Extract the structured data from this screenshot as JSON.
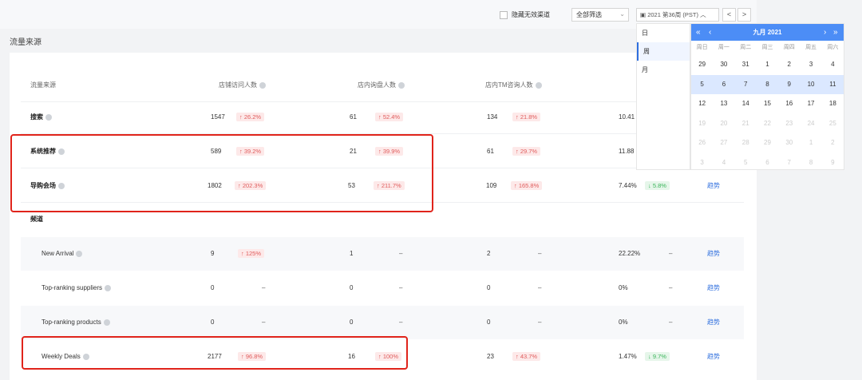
{
  "toolbar": {
    "hide_label": "隐藏无效渠道",
    "filter_value": "全部筛选",
    "date_value": "2021 第36周 (PST)",
    "prev": "<",
    "next": ">"
  },
  "section_title": "流量来源",
  "table": {
    "headers": [
      "流量来源",
      "店铺访问人数",
      "店内询盘人数",
      "店内TM咨询人数"
    ],
    "rows": [
      {
        "name": "搜索",
        "bold": true,
        "v1": "1547",
        "b1": "↑ 26.2%",
        "v2": "61",
        "b2": "↑ 52.4%",
        "v3": "134",
        "b3": "↑ 21.8%",
        "v4": "10.41",
        "b4": "",
        "act": ""
      },
      {
        "name": "系统推荐",
        "bold": true,
        "v1": "589",
        "b1": "↑ 39.2%",
        "v2": "21",
        "b2": "↑ 39.9%",
        "v3": "61",
        "b3": "↑ 29.7%",
        "v4": "11.88",
        "b4": "",
        "act": ""
      },
      {
        "name": "导购会场",
        "bold": true,
        "v1": "1802",
        "b1": "↑ 202.3%",
        "v2": "53",
        "b2": "↑ 211.7%",
        "v3": "109",
        "b3": "↑ 165.8%",
        "v4": "7.44%",
        "b4": "↓ 5.8%",
        "act": "趋势"
      },
      {
        "name": "频道",
        "bold": true
      },
      {
        "name": "New Arrival",
        "bold": false,
        "v1": "9",
        "b1": "↑ 125%",
        "v2": "1",
        "b2": "–",
        "v3": "2",
        "b3": "–",
        "v4": "22.22%",
        "b4": "–",
        "act": "趋势"
      },
      {
        "name": "Top-ranking suppliers",
        "bold": false,
        "v1": "0",
        "b1": "–",
        "v2": "0",
        "b2": "–",
        "v3": "0",
        "b3": "–",
        "v4": "0%",
        "b4": "–",
        "act": "趋势"
      },
      {
        "name": "Top-ranking products",
        "bold": false,
        "v1": "0",
        "b1": "–",
        "v2": "0",
        "b2": "–",
        "v3": "0",
        "b3": "–",
        "v4": "0%",
        "b4": "–",
        "act": "趋势"
      },
      {
        "name": "Weekly Deals",
        "bold": false,
        "v1": "2177",
        "b1": "↑ 96.8%",
        "v2": "16",
        "b2": "↑ 100%",
        "v3": "23",
        "b3": "↑ 43.7%",
        "v4": "1.47%",
        "b4": "↓ 9.7%",
        "act": "趋势"
      }
    ]
  },
  "granularity": [
    "日",
    "周",
    "月"
  ],
  "calendar": {
    "title": "九月  2021",
    "prev_year": "«",
    "prev_month": "‹",
    "next_month": "›",
    "next_year": "»",
    "weekdays": [
      "周日",
      "周一",
      "周二",
      "周三",
      "周四",
      "周五",
      "周六"
    ],
    "weeks": [
      [
        "29",
        "30",
        "31",
        "1",
        "2",
        "3",
        "4"
      ],
      [
        "5",
        "6",
        "7",
        "8",
        "9",
        "10",
        "11"
      ],
      [
        "12",
        "13",
        "14",
        "15",
        "16",
        "17",
        "18"
      ],
      [
        "19",
        "20",
        "21",
        "22",
        "23",
        "24",
        "25"
      ],
      [
        "26",
        "27",
        "28",
        "29",
        "30",
        "1",
        "2"
      ],
      [
        "3",
        "4",
        "5",
        "6",
        "7",
        "8",
        "9"
      ]
    ],
    "selected_week": 1,
    "colors": {
      "accent": "#4c8df6",
      "highlight": "#dbe8ff"
    }
  },
  "colors": {
    "up": "#e05c5c",
    "down": "#3bb55b",
    "link": "#2f6fde",
    "annotation": "#e0241b"
  }
}
